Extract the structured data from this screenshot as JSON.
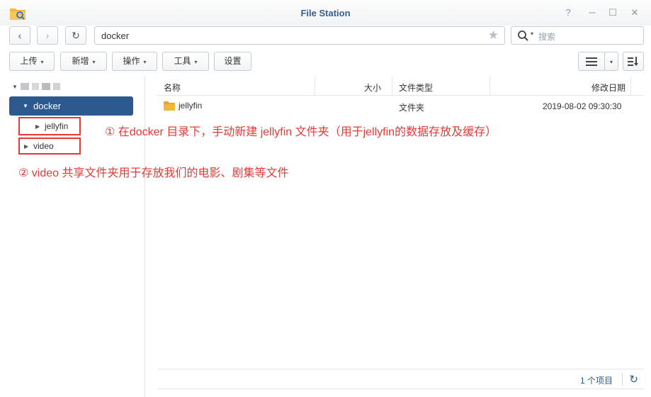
{
  "window": {
    "title": "File Station",
    "help_glyph": "?",
    "minimize_glyph": "─",
    "maximize_glyph": "☐",
    "close_glyph": "✕"
  },
  "nav": {
    "back_glyph": "‹",
    "forward_glyph": "›",
    "refresh_glyph": "↻",
    "path": "docker",
    "star_glyph": "★"
  },
  "search": {
    "placeholder": "搜索"
  },
  "toolbar": {
    "upload": "上传",
    "create": "新增",
    "action": "操作",
    "tools": "工具",
    "settings": "设置",
    "caret": "▾"
  },
  "tree": {
    "root_caret": "▼",
    "docker_label": "docker",
    "jellyfin_label": "jellyfin",
    "video_label": "video",
    "collapsed_caret": "▶",
    "expanded_caret": "▼"
  },
  "list": {
    "columns": [
      "名称",
      "大小",
      "文件类型",
      "修改日期"
    ],
    "rows": [
      {
        "name": "jellyfin",
        "size": "",
        "type": "文件夹",
        "modified": "2019-08-02 09:30:30"
      }
    ]
  },
  "annotations": {
    "note1": "① 在docker 目录下，手动新建 jellyfin 文件夹（用于jellyfin的数据存放及缓存）",
    "note2": "② video 共享文件夹用于存放我们的电影、剧集等文件"
  },
  "footer": {
    "count": "1 个项目",
    "refresh_glyph": "↻"
  },
  "colors": {
    "accent": "#2c5a8f",
    "annotation": "#e53935",
    "folder": "#f4b63a"
  }
}
